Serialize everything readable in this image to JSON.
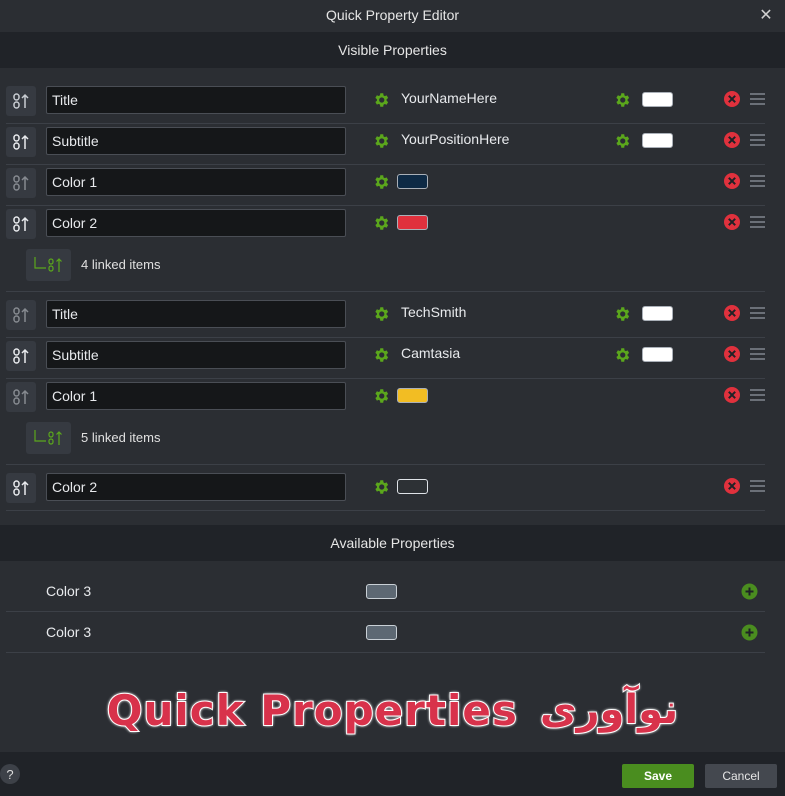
{
  "window": {
    "title": "Quick Property Editor"
  },
  "visible": {
    "header": "Visible Properties",
    "rows": [
      {
        "name": "Title",
        "value": "YourNameHere",
        "swatch": "#ffffff"
      },
      {
        "name": "Subtitle",
        "value": "YourPositionHere",
        "swatch": "#ffffff"
      },
      {
        "name": "Color 1",
        "swatch": "#0e2a45"
      },
      {
        "name": "Color 2",
        "swatch": "#e0313d"
      },
      {
        "name": "Title",
        "value": "TechSmith",
        "swatch": "#ffffff"
      },
      {
        "name": "Subtitle",
        "value": "Camtasia",
        "swatch": "#ffffff"
      },
      {
        "name": "Color 1",
        "swatch": "#f2bd23"
      },
      {
        "name": "Color 2",
        "swatch": "#2d3135"
      }
    ],
    "groups": [
      {
        "label": "4 linked items"
      },
      {
        "label": "5 linked items"
      }
    ]
  },
  "available": {
    "header": "Available Properties",
    "rows": [
      {
        "name": "Color 3",
        "swatch": "#5d6873"
      },
      {
        "name": "Color 3",
        "swatch": "#5d6873"
      }
    ]
  },
  "banner": {
    "english": "Quick Properties",
    "persian": "نوآوری"
  },
  "footer": {
    "help": "?",
    "save": "Save",
    "cancel": "Cancel"
  },
  "colors": {
    "accent_green": "#4a8d1f",
    "gear_green": "#5ba71c",
    "remove_red": "#e0313d",
    "panel_dark": "#202328",
    "panel": "#2b2e33"
  }
}
